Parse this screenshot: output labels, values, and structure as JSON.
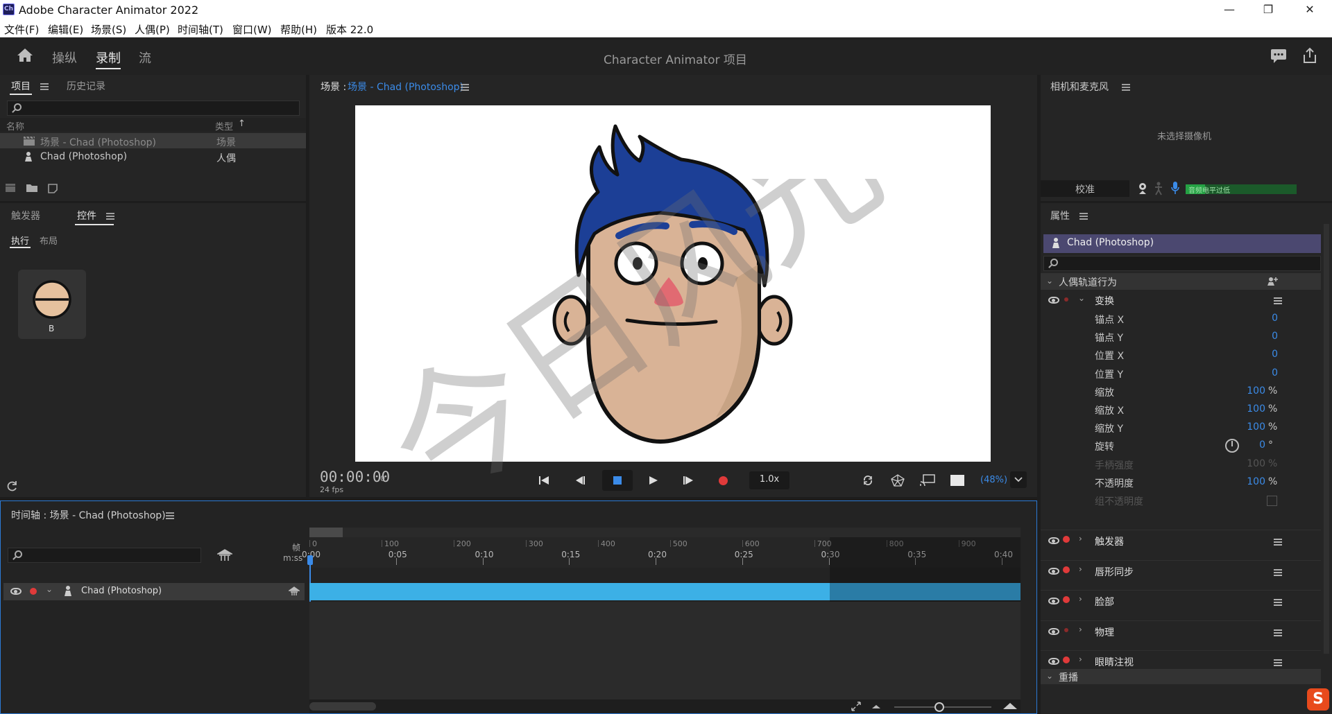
{
  "app": {
    "title": "Adobe Character Animator 2022",
    "icon_text": "Ch",
    "window_buttons": [
      "—",
      "❐",
      "✕"
    ]
  },
  "menu": [
    "文件(F)",
    "编辑(E)",
    "场景(S)",
    "人偶(P)",
    "时间轴(T)",
    "窗口(W)",
    "帮助(H)",
    "版本 22.0"
  ],
  "workspace": {
    "tabs": [
      "操纵",
      "录制",
      "流"
    ],
    "active_tab": "录制",
    "project_title": "Character Animator 项目"
  },
  "project_panel": {
    "tabs": [
      "项目",
      "历史记录"
    ],
    "columns": [
      "名称",
      "类型"
    ],
    "items": [
      {
        "name": "场景 - Chad (Photoshop)",
        "type": "场景",
        "icon": "clapper-icon"
      },
      {
        "name": "Chad (Photoshop)",
        "type": "人偶",
        "icon": "puppet-icon"
      }
    ]
  },
  "triggers_panel": {
    "tabs": [
      "触发器",
      "控件"
    ],
    "subtabs": [
      "执行",
      "布局"
    ],
    "control": {
      "key": "B"
    }
  },
  "scene_panel": {
    "label": "场景 :",
    "scene_name": "场景 - Chad (Photoshop)",
    "timecode": "00:00:00",
    "frame": "0",
    "fps": "24 fps",
    "speed": "1.0x",
    "zoom": "(48%)"
  },
  "camera_panel": {
    "title": "相机和麦克风",
    "no_camera": "未选择摄像机",
    "calibrate": "校准",
    "audio_label": "音频电平过低"
  },
  "properties_panel": {
    "title": "属性",
    "puppet": "Chad (Photoshop)",
    "section": "人偶轨道行为",
    "transform": {
      "name": "变换",
      "props": [
        {
          "label": "锚点 X",
          "value": "0",
          "unit": ""
        },
        {
          "label": "锚点 Y",
          "value": "0",
          "unit": ""
        },
        {
          "label": "位置 X",
          "value": "0",
          "unit": ""
        },
        {
          "label": "位置 Y",
          "value": "0",
          "unit": ""
        },
        {
          "label": "缩放",
          "value": "100",
          "unit": "%"
        },
        {
          "label": "缩放 X",
          "value": "100",
          "unit": "%"
        },
        {
          "label": "缩放 Y",
          "value": "100",
          "unit": "%"
        },
        {
          "label": "旋转",
          "value": "0",
          "unit": "°"
        },
        {
          "label": "手柄强度",
          "value": "100",
          "unit": "%"
        },
        {
          "label": "不透明度",
          "value": "100",
          "unit": "%"
        },
        {
          "label": "组不透明度",
          "value": "",
          "unit": ""
        }
      ]
    },
    "behaviors": [
      "触发器",
      "唇形同步",
      "脸部",
      "物理",
      "眼睛注视"
    ],
    "replay": "重播"
  },
  "timeline_panel": {
    "title": "时间轴 : 场景 - Chad (Photoshop)",
    "frame_label": "帧",
    "time_label": "m:ss",
    "frame_ticks": [
      "0",
      "100",
      "200",
      "300",
      "400",
      "500",
      "600",
      "700",
      "800",
      "900"
    ],
    "time_ticks": [
      "0:00",
      "0:05",
      "0:10",
      "0:15",
      "0:20",
      "0:25",
      "0:30",
      "0:35",
      "0:40"
    ],
    "track": "Chad (Photoshop)"
  },
  "watermark": "今日风光有用",
  "colors": {
    "accent": "#3b8be8",
    "track": "#3cb0e6",
    "record": "#e03a3a",
    "puppet_header": "#4b4870",
    "hair": "#1c3f96",
    "skin": "#d9b396",
    "nose": "#e16a72"
  }
}
